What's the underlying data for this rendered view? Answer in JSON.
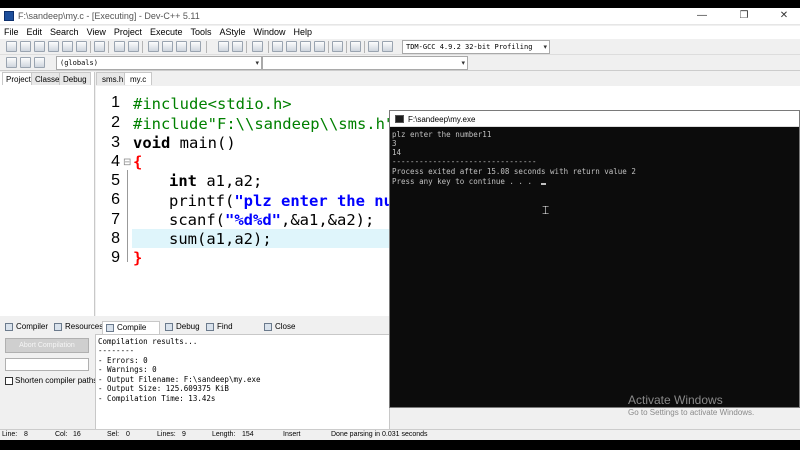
{
  "window": {
    "title": "F:\\sandeep\\my.c - [Executing] - Dev-C++ 5.11",
    "controls": [
      "—",
      "❐",
      "✕"
    ]
  },
  "menu": [
    "File",
    "Edit",
    "Search",
    "View",
    "Project",
    "Execute",
    "Tools",
    "AStyle",
    "Window",
    "Help"
  ],
  "toolbar": {
    "compiler_select": "TDM-GCC 4.9.2 32-bit Profiling",
    "scope_select": "(globals)"
  },
  "left_tabs": [
    "Project",
    "Classes",
    "Debug"
  ],
  "editor_tabs": [
    "sms.h",
    "my.c"
  ],
  "editor": {
    "line_numbers": [
      "1",
      "2",
      "3",
      "4",
      "5",
      "6",
      "7",
      "8",
      "9"
    ],
    "lines": {
      "l1": "#include<stdio.h>",
      "l2": "#include\"F:\\\\sandeep\\\\sms.h\"",
      "l3_kw": "void",
      "l3_rest": " main()",
      "l4": "{",
      "l5_kw": "int",
      "l5_rest": " a1,a2;",
      "l6_a": "printf(",
      "l6_str": "\"plz enter the numb",
      "l7_a": "scanf(",
      "l7_str": "\"%d%d\"",
      "l7_rest": ",&a1,&a2);",
      "l8": "sum(a1,a2);",
      "l9": "}"
    }
  },
  "bottom_tabs": [
    "Compiler",
    "Resources",
    "Compile Log",
    "Debug",
    "Find Results",
    "Close"
  ],
  "compile_panel": {
    "abort_label": "Abort Compilation",
    "shorten_label": "Shorten compiler paths",
    "log": [
      "Compilation results...",
      "--------",
      "- Errors: 0",
      "- Warnings: 0",
      "- Output Filename: F:\\sandeep\\my.exe",
      "- Output Size: 125.609375 KiB",
      "- Compilation Time: 13.42s"
    ]
  },
  "status_bar": {
    "line_label": "Line:",
    "line_value": "8",
    "col_label": "Col:",
    "col_value": "16",
    "sel_label": "Sel:",
    "sel_value": "0",
    "lines_label": "Lines:",
    "lines_value": "9",
    "length_label": "Length:",
    "length_value": "154",
    "mode": "Insert",
    "message": "Done parsing in 0.031 seconds"
  },
  "console": {
    "title": "F:\\sandeep\\my.exe",
    "lines": [
      "plz enter the number11",
      "3",
      "14",
      "--------------------------------",
      "Process exited after 15.08 seconds with return value 2",
      "Press any key to continue . . ."
    ]
  },
  "watermark": {
    "line1": "Activate Windows",
    "line2": "Go to Settings to activate Windows."
  },
  "colors": {
    "keyword": "#000000",
    "string": "#0000ff",
    "preprocessor": "#008000",
    "brace": "#ff0000",
    "current_line": "#dff5fb",
    "console_bg": "#0c0c0c",
    "console_fg": "#c0c0c0"
  }
}
